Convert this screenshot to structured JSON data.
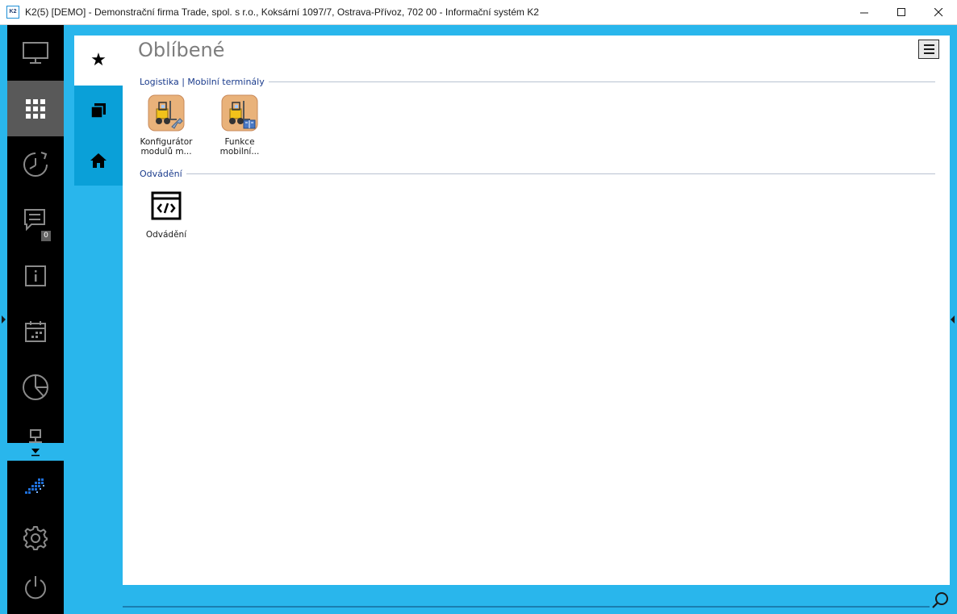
{
  "window": {
    "app_icon_text": "K2",
    "title": "K2(5) [DEMO] - Demonstrační firma Trade, spol. s r.o., Koksární 1097/7, Ostrava-Přívoz, 702 00 - Informační systém K2"
  },
  "sidebar": {
    "items": [
      {
        "name": "desktop-icon"
      },
      {
        "name": "apps-grid-icon",
        "active": true
      },
      {
        "name": "history-icon"
      },
      {
        "name": "messages-icon",
        "badge": "0"
      },
      {
        "name": "info-icon"
      },
      {
        "name": "calendar-icon"
      },
      {
        "name": "pie-chart-icon"
      },
      {
        "name": "network-icon"
      }
    ],
    "bottom": [
      {
        "name": "k2-logo-icon"
      },
      {
        "name": "settings-icon"
      },
      {
        "name": "power-icon"
      }
    ]
  },
  "tabs": [
    {
      "name": "favorites-star-icon",
      "active": true
    },
    {
      "name": "windows-icon"
    },
    {
      "name": "home-icon"
    }
  ],
  "main": {
    "title": "Oblíbené",
    "sections": [
      {
        "label": "Logistika | Mobilní terminály",
        "items": [
          {
            "line1": "Konfigurátor",
            "line2": "modulů m...",
            "icon": "forklift-wrench-icon"
          },
          {
            "line1": "Funkce",
            "line2": "mobilní...",
            "icon": "forklift-book-icon"
          }
        ]
      },
      {
        "label": "Odvádění",
        "items": [
          {
            "line1": "Odvádění",
            "icon": "code-window-icon"
          }
        ]
      }
    ]
  },
  "colors": {
    "frame": "#29b6ec",
    "sidebar": "#000000",
    "sidebar_active": "#595959",
    "tab_inactive": "#0aa0d8",
    "section_label": "#1a3b8c",
    "title_gray": "#7d7d7d"
  }
}
